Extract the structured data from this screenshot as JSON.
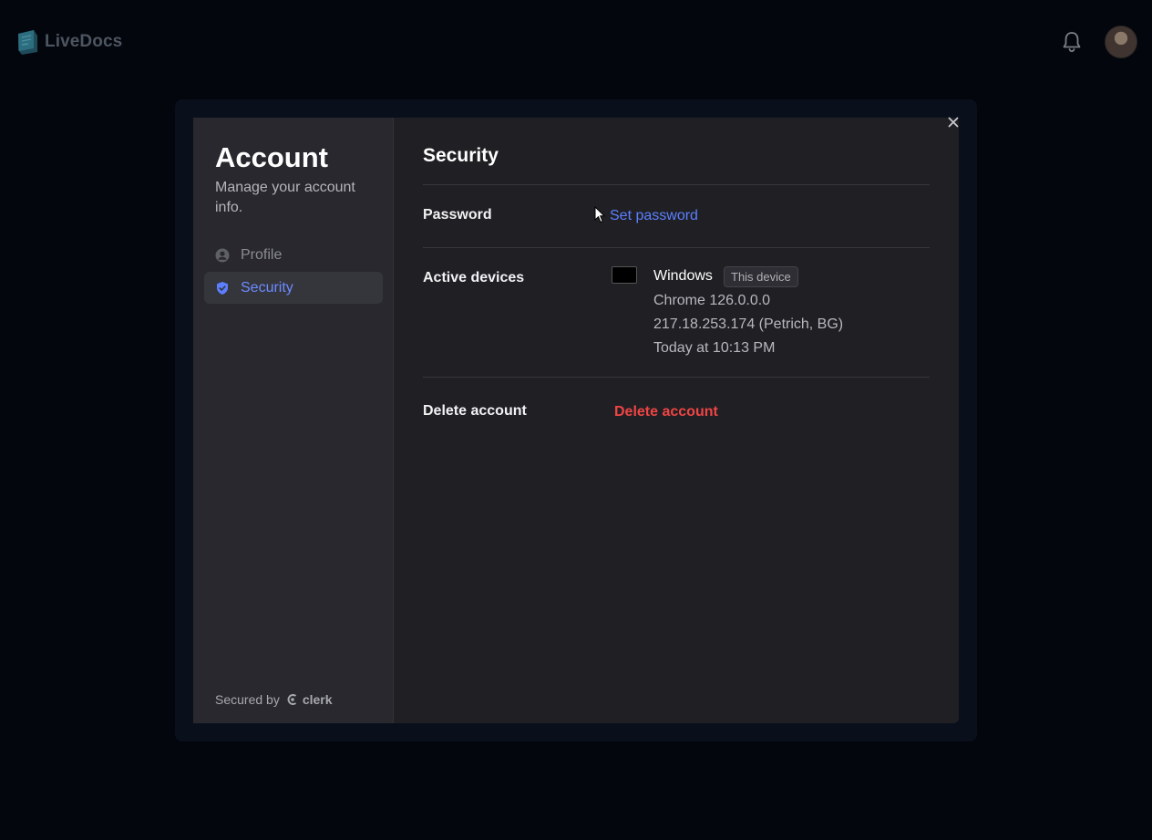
{
  "app": {
    "brand": "LiveDocs"
  },
  "header": {
    "icons": [
      "bell-icon",
      "avatar"
    ]
  },
  "sidebar": {
    "title": "Account",
    "subtitle": "Manage your account info.",
    "items": [
      {
        "label": "Profile",
        "icon": "user-circle-icon",
        "active": false
      },
      {
        "label": "Security",
        "icon": "shield-icon",
        "active": true
      }
    ],
    "secured_prefix": "Secured by",
    "secured_brand": "clerk"
  },
  "main": {
    "title": "Security",
    "password": {
      "label": "Password",
      "action": "Set password"
    },
    "devices": {
      "label": "Active devices",
      "items": [
        {
          "os": "Windows",
          "badge": "This device",
          "browser": "Chrome 126.0.0.0",
          "ip": "217.18.253.174 (Petrich, BG)",
          "time": "Today at 10:13 PM"
        }
      ]
    },
    "delete": {
      "label": "Delete account",
      "action": "Delete account"
    }
  },
  "colors": {
    "accent": "#5b7fff",
    "danger": "#ef4444",
    "background": "#03060c",
    "panel": "#202024"
  }
}
